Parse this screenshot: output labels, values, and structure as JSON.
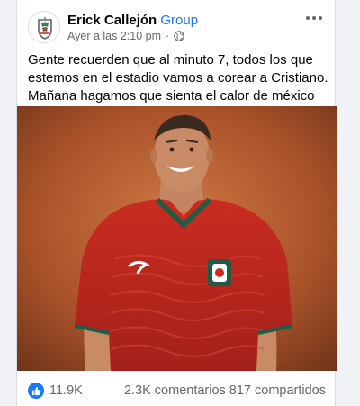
{
  "post": {
    "author": "Erick Callejón",
    "context": "Group",
    "timestamp": "Ayer a las 2:10 pm",
    "separator": "·",
    "text": "Gente recuerden que al minuto 7, todos los que estemos en el estadio vamos a corear a Cristiano. Mañana hagamos que sienta el calor de méxico"
  },
  "footer": {
    "likes": "11.9K",
    "comments": "2.3K comentarios",
    "shares": "817 compartidos"
  },
  "icons": {
    "avatar": "mexico-federation-crest-icon",
    "privacy": "globe-icon",
    "more": "more-options-icon",
    "reaction": "like-icon"
  },
  "colors": {
    "accent": "#1877f2",
    "secondary_text": "#65676b",
    "jersey": "#c0281e",
    "background": "#b35a2a"
  }
}
